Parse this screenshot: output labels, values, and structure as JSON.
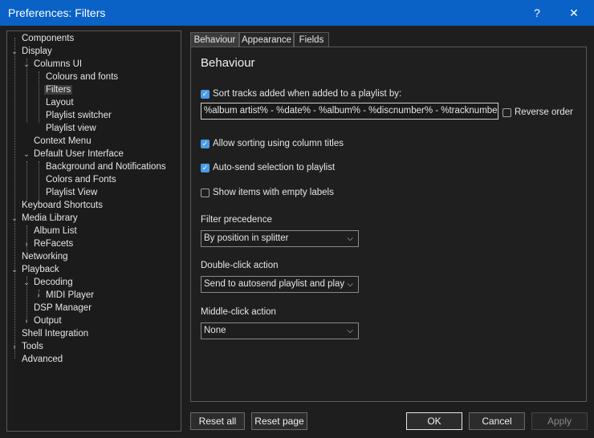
{
  "window": {
    "title": "Preferences: Filters",
    "help_glyph": "?",
    "close_glyph": "✕"
  },
  "tree": {
    "components": "Components",
    "display": "Display",
    "columns_ui": "Columns UI",
    "colours_fonts": "Colours and fonts",
    "filters": "Filters",
    "layout": "Layout",
    "playlist_switcher": "Playlist switcher",
    "playlist_view": "Playlist view",
    "context_menu": "Context Menu",
    "default_ui": "Default User Interface",
    "bg_notifications": "Background and Notifications",
    "colors_fonts": "Colors and Fonts",
    "playlist_view_dui": "Playlist View",
    "keyboard_shortcuts": "Keyboard Shortcuts",
    "media_library": "Media Library",
    "album_list": "Album List",
    "refacets": "ReFacets",
    "networking": "Networking",
    "playback": "Playback",
    "decoding": "Decoding",
    "midi_player": "MIDI Player",
    "dsp_manager": "DSP Manager",
    "output": "Output",
    "shell_integration": "Shell Integration",
    "tools": "Tools",
    "advanced": "Advanced"
  },
  "tabs": {
    "behaviour": "Behaviour",
    "appearance": "Appearance",
    "fields": "Fields"
  },
  "panel": {
    "heading": "Behaviour",
    "sort_label": "Sort tracks added when added to a playlist by:",
    "sort_pattern": "%album artist% - %date% - %album% - %discnumber% - %tracknumber%",
    "reverse_order": "Reverse order",
    "allow_sorting": "Allow sorting using column titles",
    "auto_send": "Auto-send selection to playlist",
    "show_empty": "Show items with empty labels",
    "filter_precedence_label": "Filter precedence",
    "filter_precedence_value": "By position in splitter",
    "double_click_label": "Double-click action",
    "double_click_value": "Send to autosend playlist and play",
    "middle_click_label": "Middle-click action",
    "middle_click_value": "None"
  },
  "buttons": {
    "reset_all": "Reset all",
    "reset_page": "Reset page",
    "ok": "OK",
    "cancel": "Cancel",
    "apply": "Apply"
  },
  "glyphs": {
    "expanded": "⌄",
    "collapsed": "›",
    "check": "✓",
    "dropdown": "⌵"
  },
  "colors": {
    "titlebar": "#0a62c7",
    "accent": "#4c9be8",
    "background": "#1e1e1e"
  }
}
